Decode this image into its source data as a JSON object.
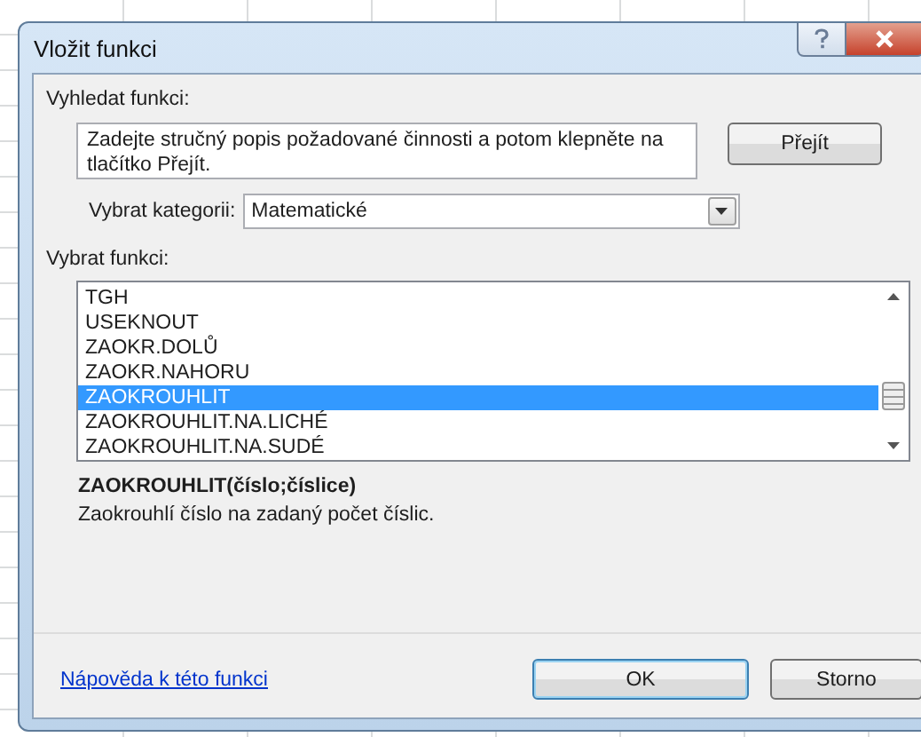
{
  "window": {
    "title": "Vložit funkci"
  },
  "search": {
    "label": "Vyhledat funkci:",
    "value": "Zadejte stručný popis požadované činnosti a potom klepněte na tlačítko Přejít.",
    "button": "Přejít"
  },
  "category": {
    "label": "Vybrat kategorii:",
    "value": "Matematické"
  },
  "functions": {
    "label": "Vybrat funkci:",
    "items": [
      {
        "name": "TGH",
        "selected": false
      },
      {
        "name": "USEKNOUT",
        "selected": false
      },
      {
        "name": "ZAOKR.DOLŮ",
        "selected": false
      },
      {
        "name": "ZAOKR.NAHORU",
        "selected": false
      },
      {
        "name": "ZAOKROUHLIT",
        "selected": true
      },
      {
        "name": "ZAOKROUHLIT.NA.LICHÉ",
        "selected": false
      },
      {
        "name": "ZAOKROUHLIT.NA.SUDÉ",
        "selected": false
      }
    ]
  },
  "signature": "ZAOKROUHLIT(číslo;číslice)",
  "description": "Zaokrouhlí číslo na zadaný počet číslic.",
  "help_link": "Nápověda k této funkci",
  "buttons": [
    {
      "label": "OK",
      "kind": "default"
    },
    {
      "label": "Storno",
      "kind": "normal"
    }
  ]
}
